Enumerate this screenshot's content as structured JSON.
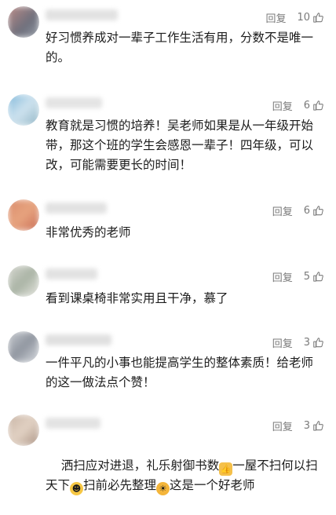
{
  "comments": [
    {
      "reply_label": "回复",
      "likes": "10",
      "text": "好习惯养成对一辈子工作生活有用，分数不是唯一的。"
    },
    {
      "reply_label": "回复",
      "likes": "6",
      "text": "教育就是习惯的培养！吴老师如果是从一年级开始带，那这个班的学生会感恩一辈子！四年级，可以改，可能需要更长的时间！"
    },
    {
      "reply_label": "回复",
      "likes": "6",
      "text": "非常优秀的老师"
    },
    {
      "reply_label": "回复",
      "likes": "5",
      "text": "看到课桌椅非常实用且干净，慕了"
    },
    {
      "reply_label": "回复",
      "likes": "3",
      "text": "一件平凡的小事也能提高学生的整体素质！给老师的这一做法点个赞！"
    },
    {
      "reply_label": "回复",
      "likes": "3",
      "text_part1": "洒扫应对进退，礼乐射御书数",
      "text_part2": "一屋不扫何以扫天下",
      "text_part3": "扫前必先整理",
      "text_part4": "这是一个好老师",
      "emoji1": "thumbs-up-emoji",
      "emoji2": "grinning-emoji",
      "emoji3": "sun-emoji"
    }
  ],
  "colors": {
    "action_text": "#7a7a7a",
    "comment_text": "#1c1c1c"
  }
}
